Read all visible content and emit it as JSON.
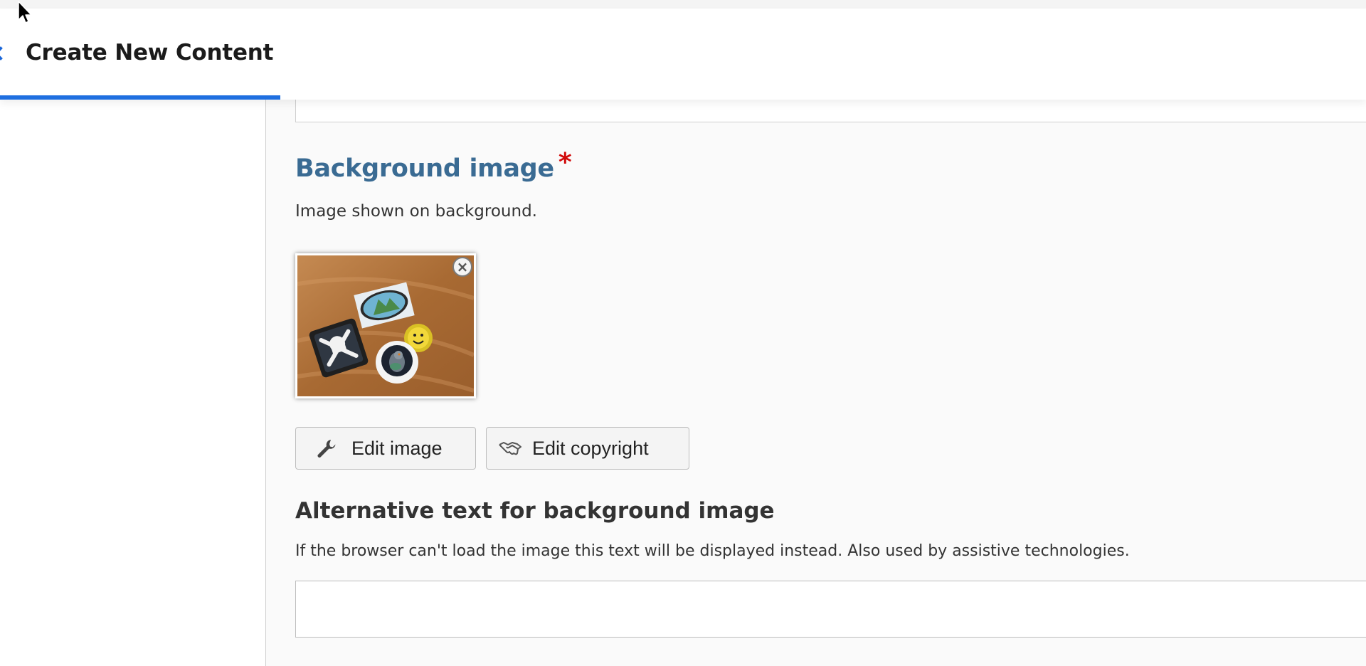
{
  "header": {
    "title": "Create New Content"
  },
  "background_image": {
    "title": "Background image",
    "required_marker": "*",
    "description": "Image shown on background.",
    "remove_label": "×"
  },
  "buttons": {
    "edit_image": "Edit image",
    "edit_copyright": "Edit copyright"
  },
  "alt_text": {
    "title": "Alternative text for background image",
    "description": "If the browser can't load the image this text will be displayed instead. Also used by assistive technologies.",
    "value": "",
    "placeholder": ""
  },
  "colors": {
    "accent": "#1f6fe0",
    "field_title": "#3a6b93",
    "required": "#d10a0a"
  },
  "icons": {
    "back": "chevron-left-icon",
    "edit_image": "wrench-icon",
    "edit_copyright": "handshake-icon",
    "remove": "close-icon"
  }
}
